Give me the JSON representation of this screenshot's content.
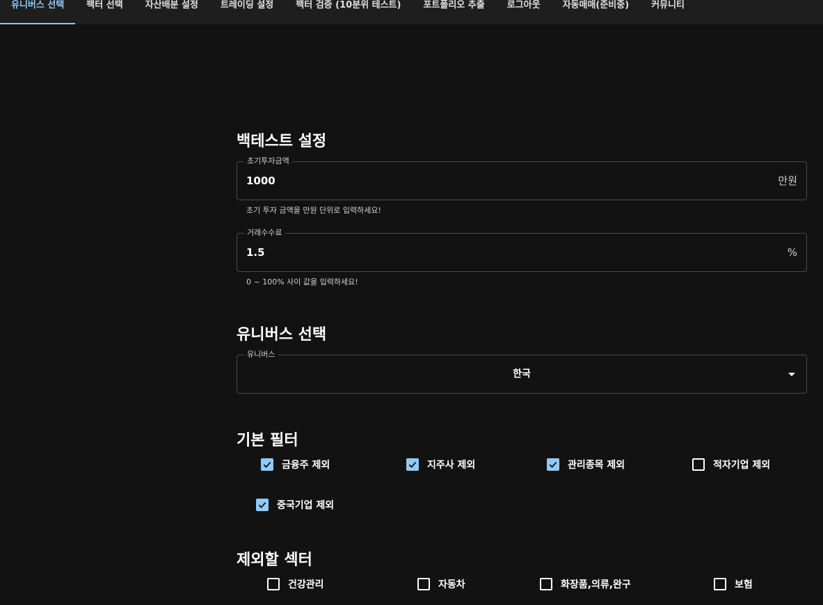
{
  "nav": {
    "tabs": [
      {
        "label": "유니버스 선택",
        "active": true
      },
      {
        "label": "팩터 선택",
        "active": false
      },
      {
        "label": "자산배분 설정",
        "active": false
      },
      {
        "label": "트레이딩 설정",
        "active": false
      },
      {
        "label": "팩터 검증 (10분위 테스트)",
        "active": false
      },
      {
        "label": "포트폴리오 추출",
        "active": false
      },
      {
        "label": "로그아웃",
        "active": false
      },
      {
        "label": "자동매매(준비중)",
        "active": false
      },
      {
        "label": "커뮤니티",
        "active": false
      }
    ],
    "accent_color": "#90caf9"
  },
  "backtest": {
    "title": "백테스트 설정",
    "initial_amount": {
      "label": "초기투자금액",
      "value": "1000",
      "unit": "만원",
      "helper": "초기 투자 금액을 만원 단위로 입력하세요!"
    },
    "fee": {
      "label": "거래수수료",
      "value": "1.5",
      "unit": "%",
      "helper": "0 ~ 100% 사이 값을 입력하세요!"
    }
  },
  "universe": {
    "title": "유니버스 선택",
    "select": {
      "label": "유니버스",
      "value": "한국",
      "icon": "arrow-drop-down-icon"
    }
  },
  "basic_filter": {
    "title": "기본 필터",
    "items": [
      {
        "label": "금융주 제외",
        "checked": true
      },
      {
        "label": "지주사 제외",
        "checked": true
      },
      {
        "label": "관리종목 제외",
        "checked": true
      },
      {
        "label": "적자기업 제외",
        "checked": false
      },
      {
        "label": "중국기업 제외",
        "checked": true
      }
    ]
  },
  "exclude_sectors": {
    "title": "제외할 섹터",
    "items": [
      {
        "label": "건강관리",
        "checked": false
      },
      {
        "label": "자동차",
        "checked": false
      },
      {
        "label": "화장품,의류,완구",
        "checked": false
      },
      {
        "label": "보험",
        "checked": false
      }
    ]
  }
}
